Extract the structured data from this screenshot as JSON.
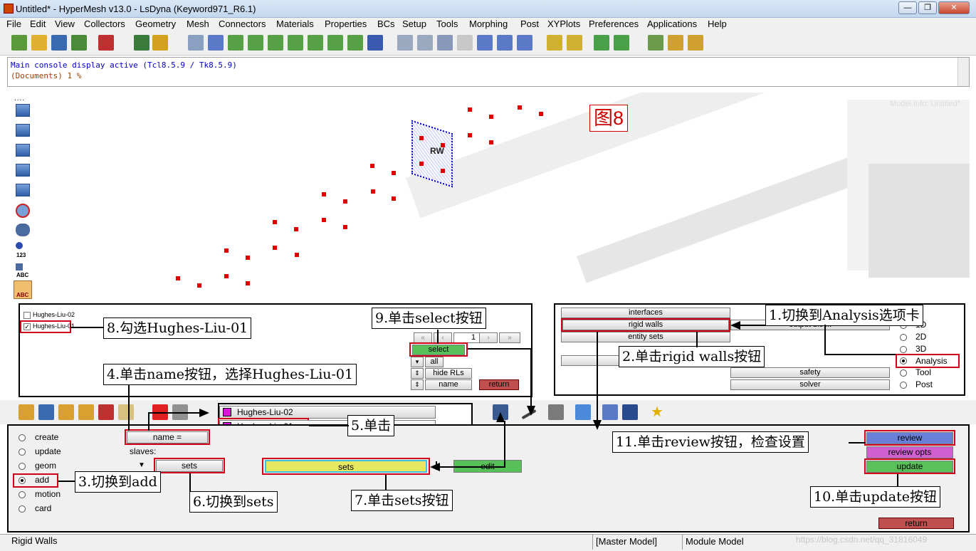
{
  "window": {
    "title": "Untitled* - HyperMesh v13.0 - LsDyna (Keyword971_R6.1)",
    "minimize": "—",
    "maximize": "❐",
    "close": "✕"
  },
  "menu": [
    "File",
    "Edit",
    "View",
    "Collectors",
    "Geometry",
    "Mesh",
    "Connectors",
    "Materials",
    "Properties",
    "BCs",
    "Setup",
    "Tools",
    "Morphing",
    "Post",
    "XYPlots",
    "Preferences",
    "Applications",
    "Help"
  ],
  "console": {
    "line1": "Main console display active (Tcl8.5.9 / Tk8.5.9)",
    "line2": "(Documents) 1 %"
  },
  "viewport": {
    "model_info": "Model Info: Untitled*",
    "rigid_wall_label": "RW",
    "left_tools": {
      "label_123": "123",
      "label_abc": "ABC",
      "label_abc2": "ABC"
    },
    "figure_label": "图8"
  },
  "collector_list": {
    "items": [
      {
        "label": "Hughes-Liu-02",
        "checked": false
      },
      {
        "label": "Hughes-Liu-01",
        "checked": true
      }
    ]
  },
  "selector_panel": {
    "nav": [
      "«",
      "‹",
      "1",
      "›",
      "»"
    ],
    "select": "select",
    "all": "all",
    "hide_rls": "hide RLs",
    "name": "name",
    "return": "return",
    "sort_icon": "⇕",
    "updown_icon": "⇕",
    "dropdown_icon": "▾"
  },
  "analysis_panel": {
    "buttons": [
      "interfaces",
      "rigid walls",
      "entity sets"
    ],
    "output_block": "output block",
    "safety": "safety",
    "solver": "solver",
    "radios": [
      {
        "label": "1D",
        "checked": false
      },
      {
        "label": "2D",
        "checked": false
      },
      {
        "label": "3D",
        "checked": false
      },
      {
        "label": "Analysis",
        "checked": true
      },
      {
        "label": "Tool",
        "checked": false
      },
      {
        "label": "Post",
        "checked": false
      }
    ]
  },
  "name_popup": {
    "items": [
      "Hughes-Liu-02",
      "Hughes-Liu-01"
    ],
    "swatch_color": "#e010e0"
  },
  "rigid_walls_panel": {
    "modes": [
      {
        "label": "create",
        "checked": false
      },
      {
        "label": "update",
        "checked": false
      },
      {
        "label": "geom",
        "checked": false
      },
      {
        "label": "add",
        "checked": true
      },
      {
        "label": "motion",
        "checked": false
      },
      {
        "label": "card",
        "checked": false
      }
    ],
    "name_button": "name =",
    "slaves_label": "slaves:",
    "sets_toggle": "sets",
    "sets_button": "sets",
    "edit_button": "edit",
    "review": "review",
    "review_opts": "review opts",
    "update": "update",
    "return": "return",
    "down_icon": "▼"
  },
  "status": {
    "panel_name": "Rigid Walls",
    "master_model": "[Master Model]",
    "module_model": "Module Model",
    "watermark": "https://blog.csdn.net/qq_31816049"
  },
  "annotations": {
    "a1": "1.切换到Analysis选项卡",
    "a2": "2.单击rigid walls按钮",
    "a3": "3.切换到add",
    "a4": "4.单击name按钮，选择Hughes-Liu-01",
    "a5": "5.单击",
    "a6": "6.切换到sets",
    "a7": "7.单击sets按钮",
    "a8": "8.勾选Hughes-Liu-01",
    "a9": "9.单击select按钮",
    "a10": "10.单击update按钮",
    "a11": "11.单击review按钮，检查设置"
  },
  "colors": {
    "annotation_red": "#d0001a",
    "review_blue": "#6a7fd8",
    "review_opts_magenta": "#d060d0",
    "update_green": "#5ac05a",
    "sets_yellow": "#e8e860",
    "return_red": "#c05050"
  }
}
